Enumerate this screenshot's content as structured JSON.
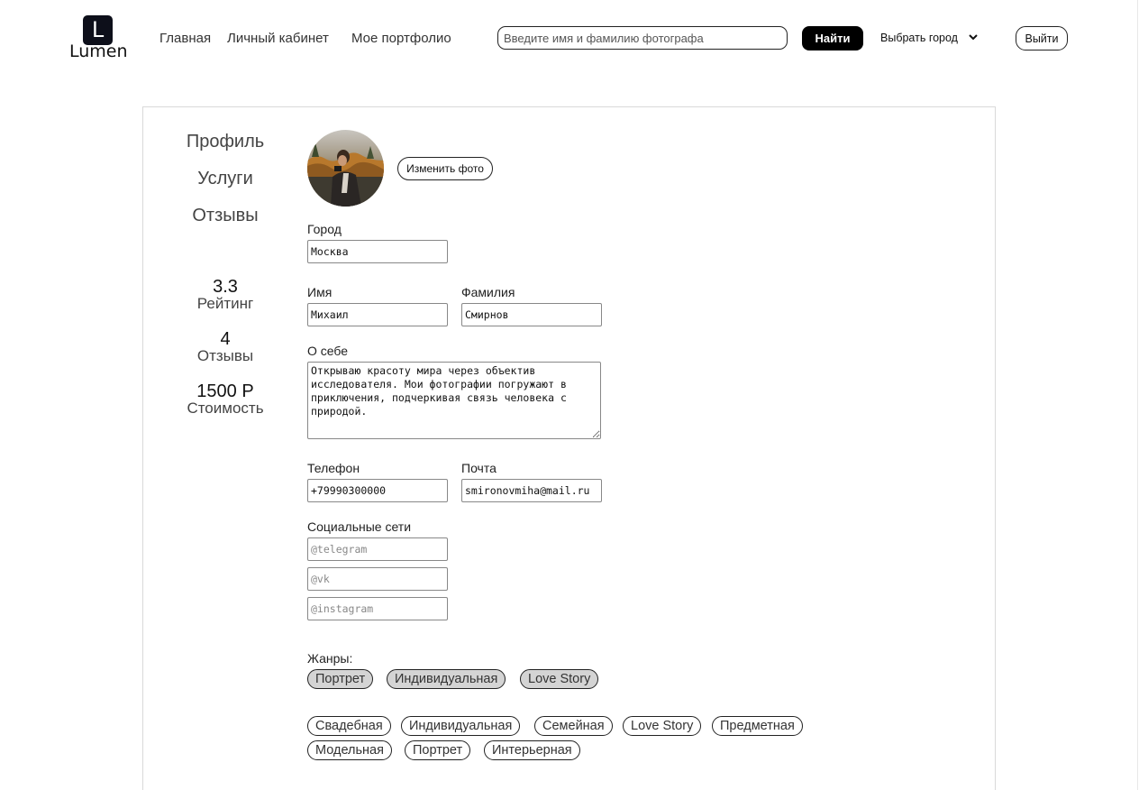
{
  "header": {
    "logo_letter": "L",
    "logo_text": "Lumen",
    "nav": [
      "Главная",
      "Личный кабинет",
      "Мое портфолио"
    ],
    "search_placeholder": "Введите имя и фамилию фотографа",
    "find_label": "Найти",
    "city_label": "Выбрать город",
    "logout_label": "Выйти"
  },
  "sidebar": {
    "links": [
      "Профиль",
      "Услуги",
      "Отзывы"
    ],
    "stats": [
      {
        "value": "3.3",
        "label": "Рейтинг"
      },
      {
        "value": "4",
        "label": "Отзывы"
      },
      {
        "value": "1500 Р",
        "label": "Стоимость"
      }
    ]
  },
  "profile": {
    "change_photo_label": "Изменить фото",
    "city_label": "Город",
    "city_value": "Москва",
    "first_name_label": "Имя",
    "first_name_value": "Михаил",
    "last_name_label": "Фамилия",
    "last_name_value": "Смирнов",
    "about_label": "О себе",
    "about_value": "Открываю красоту мира через объектив исследователя. Мои фотографии погружают в приключения, подчеркивая связь человека с природой.",
    "phone_label": "Телефон",
    "phone_value": "+79990300000",
    "email_label": "Почта",
    "email_value": "smironovmiha@mail.ru",
    "social_label": "Социальные сети",
    "social_placeholders": [
      "@telegram",
      "@vk",
      "@instagram"
    ],
    "genres_label": "Жанры:",
    "selected_genres": [
      "Портрет",
      "Индивидуальная",
      "Love Story"
    ],
    "available_genres_row1": [
      "Свадебная",
      "Индивидуальная",
      "Семейная",
      "Love Story",
      "Предметная"
    ],
    "available_genres_row2": [
      "Модельная",
      "Портрет",
      "Интерьерная"
    ]
  },
  "colors": {
    "accent": "#000000",
    "logo_bg": "#0d0f1a",
    "chip_selected": "#d4d4d4"
  },
  "icons": {
    "city_dropdown": "chevron-down-icon",
    "avatar": "photographer-avatar"
  }
}
